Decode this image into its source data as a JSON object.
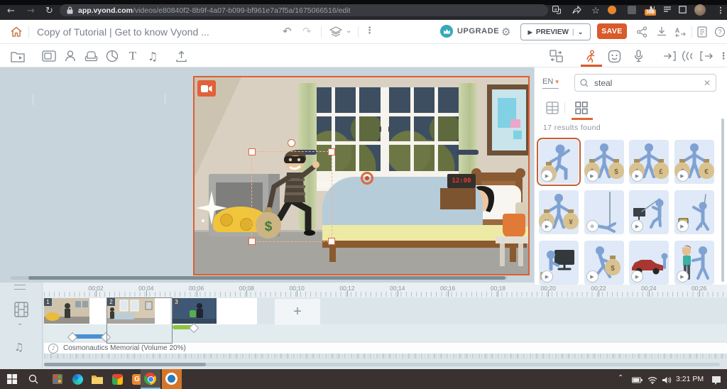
{
  "colors": {
    "accent": "#DD5C2F",
    "teal_upgrade": "#35AAB8",
    "blue_motion_bar": "#4A8FD4",
    "green_motion_bar": "#8DC63F",
    "selected_thumb_border": "#C55F34"
  },
  "browser": {
    "url_domain": "app.vyond.com",
    "url_path": "/videos/e80840f2-8b9f-4a07-b099-bf961e7a7f5a/1675066516/edit",
    "extension_badge": "302"
  },
  "header": {
    "title": "Copy of Tutorial | Get to know Vyond ...",
    "upgrade_label": "UPGRADE",
    "preview_label": "PREVIEW",
    "save_label": "SAVE"
  },
  "panel": {
    "language": "EN",
    "search_value": "steal",
    "results_text": "17 results found",
    "items": [
      {
        "name": "character-kneeling-with-money-bag",
        "fig": "kneel",
        "badge": "play",
        "selected": true
      },
      {
        "name": "character-holding-two-money-bags-dollar",
        "fig": "bags",
        "sym": "$",
        "badge": "play"
      },
      {
        "name": "character-holding-two-money-bags-pound",
        "fig": "bags",
        "sym": "£",
        "badge": "play"
      },
      {
        "name": "character-holding-two-money-bags-euro",
        "fig": "bags",
        "sym": "€",
        "badge": "play"
      },
      {
        "name": "character-holding-two-money-bags-yen",
        "fig": "bags",
        "sym": "¥",
        "badge": "play"
      },
      {
        "name": "character-crawling-under-pole",
        "fig": "limbo",
        "badge": "zoom"
      },
      {
        "name": "character-fishing-monitor",
        "fig": "fish",
        "badge": "play"
      },
      {
        "name": "character-stealing-object-with-stick",
        "fig": "throw",
        "badge": "play"
      },
      {
        "name": "character-behind-monitor",
        "fig": "monitor",
        "badge": "play"
      },
      {
        "name": "character-sneaking-with-money-bag",
        "fig": "sneak",
        "badge": "play"
      },
      {
        "name": "character-stealing-car",
        "fig": "car",
        "badge": "play"
      },
      {
        "name": "character-pickpocketing-man",
        "fig": "pickpocket",
        "badge": "play"
      }
    ]
  },
  "stage": {
    "clock_time": "12:00"
  },
  "timeline": {
    "ruler_labels": [
      "00:02",
      "00:04",
      "00:06",
      "00:08",
      "00:10",
      "00:12",
      "00:14",
      "00:16",
      "00:18",
      "00:20",
      "00:22",
      "00:24",
      "00:26"
    ],
    "scenes": [
      {
        "number": "1",
        "selected": false
      },
      {
        "number": "2",
        "selected": true
      },
      {
        "number": "3",
        "selected": false
      }
    ],
    "add_label": "+",
    "audio_label": "Cosmonautics Memorial (Volume 20%)"
  },
  "taskbar": {
    "time": "3:21 PM"
  }
}
